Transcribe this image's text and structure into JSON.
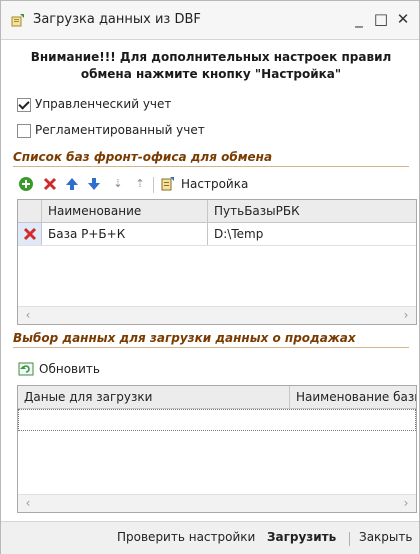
{
  "window": {
    "title": "Загрузка данных из DBF"
  },
  "notice": {
    "line1": "Внимание!!! Для дополнительных настроек правил",
    "line2": "обмена нажмите кнопку \"Настройка\""
  },
  "checkboxes": [
    {
      "label": "Управленческий учет",
      "checked": true
    },
    {
      "label": "Регламентированный учет",
      "checked": false
    }
  ],
  "frontoffice": {
    "section_title": "Список баз фронт-офиса для обмена",
    "toolbar": {
      "settings_label": "Настройка"
    },
    "columns": [
      "Наименование",
      "ПутьБазыРБК"
    ],
    "rows": [
      {
        "name": "База Р+Б+К",
        "path": "D:\\Temp"
      }
    ]
  },
  "sales": {
    "section_title": "Выбор данных для загрузки данных о продажах",
    "refresh_label": "Обновить",
    "columns": [
      "Даные для загрузки",
      "Наименование базы"
    ]
  },
  "footer": {
    "check_label": "Проверить настройки",
    "load_label": "Загрузить",
    "close_label": "Закрыть"
  },
  "colors": {
    "section": "#7a3b00",
    "accent_green": "#3c9a2c",
    "delete_red": "#d22b2b",
    "arrow_blue": "#2e6fcf"
  },
  "icons": [
    "app-icon",
    "minimize-icon",
    "maximize-icon",
    "close-icon",
    "add-icon",
    "delete-icon",
    "move-up-icon",
    "move-down-icon",
    "sort-asc-icon",
    "sort-desc-icon",
    "settings-icon",
    "refresh-icon",
    "row-marker-icon"
  ]
}
